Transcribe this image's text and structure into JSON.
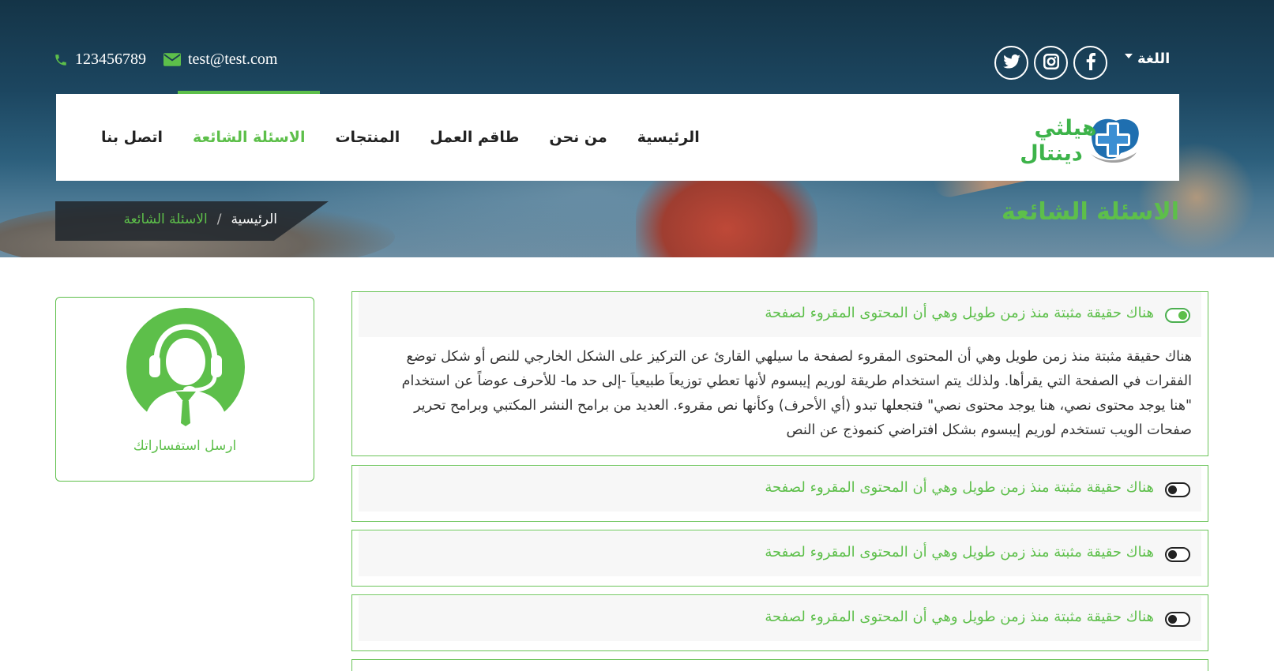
{
  "contact": {
    "phone": "123456789",
    "email": "test@test.com"
  },
  "icons": {
    "phone": "phone-icon",
    "email": "envelope-icon",
    "twitter": "twitter-icon",
    "instagram": "instagram-icon",
    "facebook": "facebook-icon",
    "agent": "customer-support-icon"
  },
  "language": {
    "label": "اللغة"
  },
  "logo": {
    "line1": "هيلثي",
    "line2": "دينتال"
  },
  "nav": {
    "items": [
      {
        "label": "الرئيسية"
      },
      {
        "label": "من نحن"
      },
      {
        "label": "طاقم العمل"
      },
      {
        "label": "المنتجات"
      },
      {
        "label": "الاسئلة الشائعة",
        "active": true
      },
      {
        "label": "اتصل بنا"
      }
    ]
  },
  "page_title": "الاسئلة الشائعة",
  "breadcrumb": {
    "home": "الرئيسية",
    "separator": "/",
    "current": "الاسئلة الشائعة"
  },
  "sidebar": {
    "label": "ارسل استفساراتك"
  },
  "faq": {
    "items": [
      {
        "question": "هناك حقيقة مثبتة منذ زمن طويل وهي أن المحتوى المقروء لصفحة",
        "expanded": true,
        "answer": "هناك حقيقة مثبتة منذ زمن طويل وهي أن المحتوى المقروء لصفحة ما سيلهي القارئ عن التركيز على الشكل الخارجي للنص أو شكل توضع الفقرات في الصفحة التي يقرأها. ولذلك يتم استخدام طريقة لوريم إيبسوم لأنها تعطي توزيعاَ طبيعياَ -إلى حد ما- للأحرف عوضاً عن استخدام \"هنا يوجد محتوى نصي، هنا يوجد محتوى نصي\" فتجعلها تبدو (أي الأحرف) وكأنها نص مقروء. العديد من برامح النشر المكتبي وبرامح تحرير صفحات الويب تستخدم لوريم إيبسوم بشكل افتراضي كنموذج عن النص"
      },
      {
        "question": "هناك حقيقة مثبتة منذ زمن طويل وهي أن المحتوى المقروء لصفحة",
        "expanded": false
      },
      {
        "question": "هناك حقيقة مثبتة منذ زمن طويل وهي أن المحتوى المقروء لصفحة",
        "expanded": false
      },
      {
        "question": "هناك حقيقة مثبتة منذ زمن طويل وهي أن المحتوى المقروء لصفحة",
        "expanded": false
      }
    ]
  },
  "colors": {
    "accent": "#5dbf4a",
    "hero_dark": "#143447",
    "text": "#333333"
  }
}
